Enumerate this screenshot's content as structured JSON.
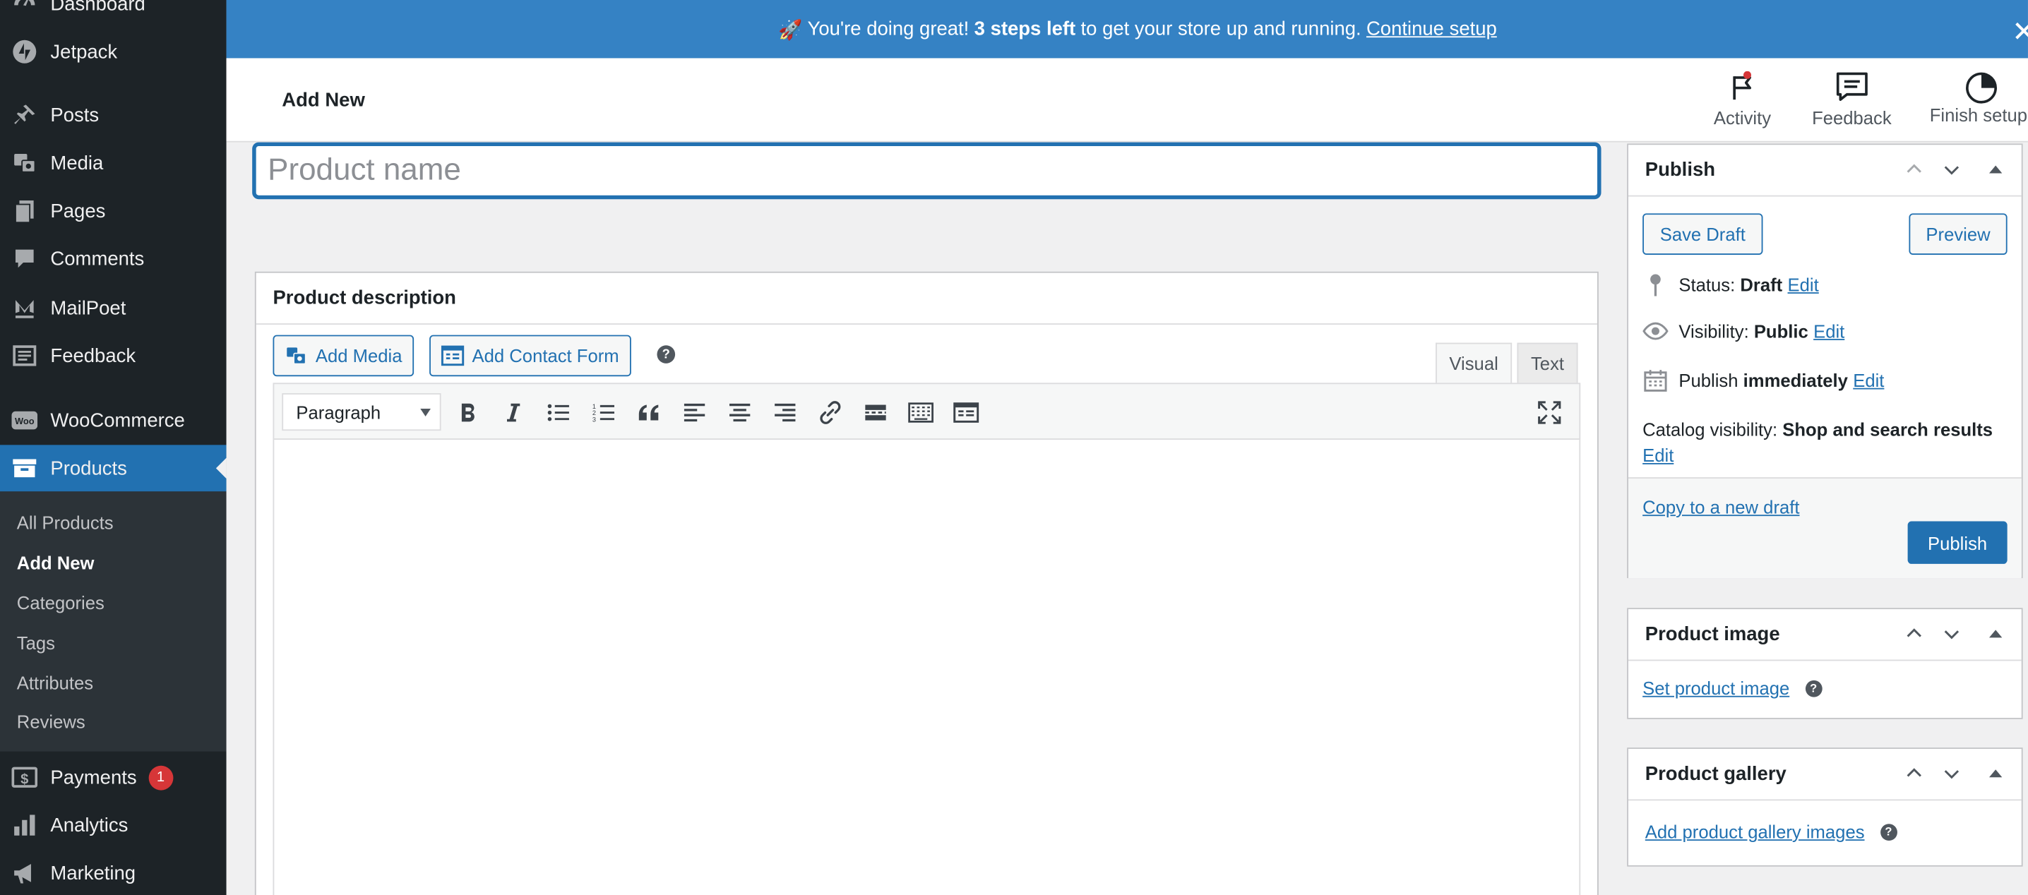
{
  "sidebar": {
    "items": [
      {
        "label": "Dashboard",
        "icon": "dashboard-icon"
      },
      {
        "label": "Jetpack",
        "icon": "jetpack-icon"
      },
      {
        "label": "Posts",
        "icon": "pin-icon"
      },
      {
        "label": "Media",
        "icon": "media-icon"
      },
      {
        "label": "Pages",
        "icon": "pages-icon"
      },
      {
        "label": "Comments",
        "icon": "comment-icon"
      },
      {
        "label": "MailPoet",
        "icon": "mailpoet-icon"
      },
      {
        "label": "Feedback",
        "icon": "feedback-icon"
      },
      {
        "label": "WooCommerce",
        "icon": "woo-icon"
      },
      {
        "label": "Products",
        "icon": "archive-icon"
      },
      {
        "label": "Payments",
        "icon": "dollar-icon",
        "badge": "1"
      },
      {
        "label": "Analytics",
        "icon": "bar-chart-icon"
      },
      {
        "label": "Marketing",
        "icon": "megaphone-icon"
      }
    ],
    "submenu": [
      "All Products",
      "Add New",
      "Categories",
      "Tags",
      "Attributes",
      "Reviews"
    ]
  },
  "notice": {
    "emoji": "🚀",
    "text_before": "You're doing great!",
    "bold": "3 steps left",
    "text_after": "to get your store up and running.",
    "link": "Continue setup"
  },
  "header": {
    "title": "Add New",
    "buttons": [
      {
        "label": "Activity",
        "icon": "flag-icon"
      },
      {
        "label": "Feedback",
        "icon": "feedback-icon"
      },
      {
        "label": "Finish setup",
        "icon": "progress-circle-icon"
      }
    ]
  },
  "editor": {
    "title_placeholder": "Product name",
    "description_heading": "Product description",
    "add_media": "Add Media",
    "add_contact_form": "Add Contact Form",
    "help": "?",
    "tab_visual": "Visual",
    "tab_text": "Text",
    "format_select": "Paragraph",
    "toolbar_icons": [
      "bold-icon",
      "italic-icon",
      "bullet-list-icon",
      "numbered-list-icon",
      "blockquote-icon",
      "align-left-icon",
      "align-center-icon",
      "align-right-icon",
      "link-icon",
      "read-more-icon",
      "toolbar-toggle-icon",
      "form-icon"
    ],
    "fullscreen_icon": "fullscreen-icon"
  },
  "publish": {
    "heading": "Publish",
    "save_draft": "Save Draft",
    "preview": "Preview",
    "status_label": "Status:",
    "status_value": "Draft",
    "visibility_label": "Visibility:",
    "visibility_value": "Public",
    "publish_label": "Publish",
    "publish_value": "immediately",
    "catalog_label": "Catalog visibility:",
    "catalog_value": "Shop and search results",
    "edit": "Edit",
    "copy_draft": "Copy to a new draft",
    "publish_button": "Publish"
  },
  "product_image": {
    "heading": "Product image",
    "link": "Set product image",
    "help": "?"
  },
  "product_gallery": {
    "heading": "Product gallery",
    "link": "Add product gallery images",
    "help": "?"
  },
  "colors": {
    "admin_bar": "#1d2327",
    "accent": "#2271b1",
    "notice": "#3582c4",
    "badge": "#d63638"
  }
}
